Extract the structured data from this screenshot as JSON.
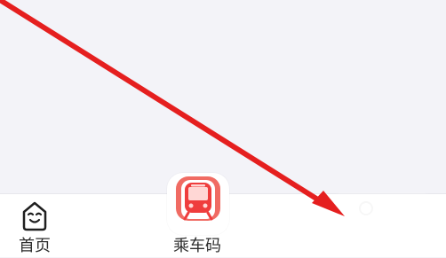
{
  "tabbar": {
    "items": [
      {
        "label": "首页",
        "icon": "home-face-icon"
      },
      {
        "label": "乘车码",
        "icon": "train-icon"
      },
      {
        "label": "",
        "icon": "profile-icon"
      }
    ]
  },
  "annotation": {
    "arrow_color": "#e51f1f"
  },
  "colors": {
    "background": "#f3f3f8",
    "tab_text": "#2d2d2d",
    "accent": "#e83a3a",
    "white": "#ffffff"
  }
}
